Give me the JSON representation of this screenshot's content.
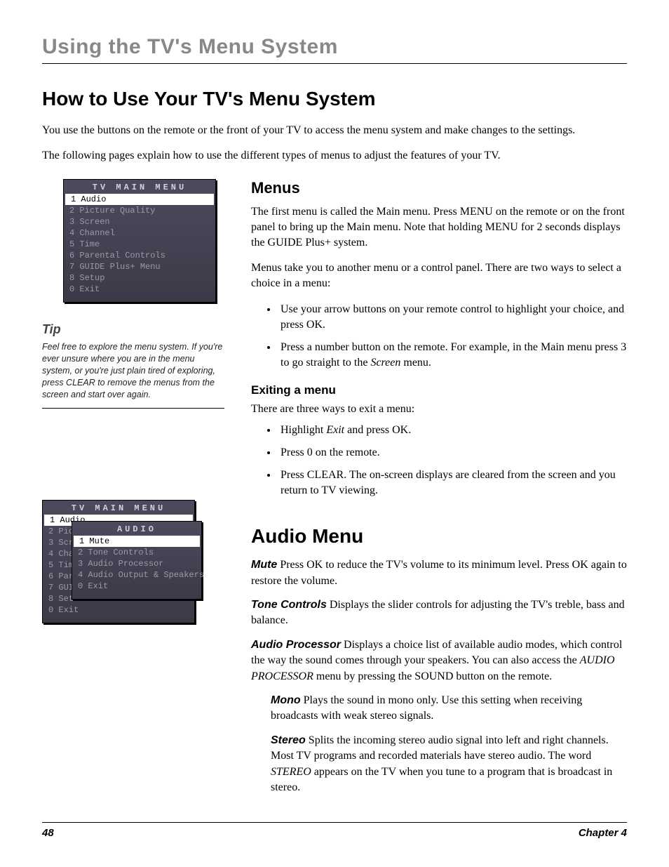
{
  "running_head": "Using the TV's Menu System",
  "h1": "How to Use Your TV's Menu System",
  "intro1": "You use the buttons on the remote or the front of your TV to access the menu system and make changes to the settings.",
  "intro2": "The following pages explain how to use the different types of menus to adjust the features of your TV.",
  "osd1": {
    "title": "TV MAIN MENU",
    "items": [
      {
        "n": "1",
        "label": "Audio",
        "selected": true
      },
      {
        "n": "2",
        "label": "Picture Quality"
      },
      {
        "n": "3",
        "label": "Screen"
      },
      {
        "n": "4",
        "label": "Channel"
      },
      {
        "n": "5",
        "label": "Time"
      },
      {
        "n": "6",
        "label": "Parental Controls"
      },
      {
        "n": "7",
        "label": "GUIDE Plus+ Menu"
      },
      {
        "n": "8",
        "label": "Setup"
      },
      {
        "n": "0",
        "label": "Exit"
      }
    ]
  },
  "tip": {
    "title": "Tip",
    "body": "Feel free to explore the menu system. If you're ever unsure where you are in the menu system, or you're just plain tired of exploring, press CLEAR to remove the menus from the screen and start over again."
  },
  "menus": {
    "heading": "Menus",
    "p1": "The first menu is called the Main menu. Press MENU on the remote or on the front panel to bring up the Main menu. Note that holding MENU for 2 seconds displays the GUIDE Plus+ system.",
    "p2": "Menus take you to another menu or a control panel. There are two ways to select a choice in a menu:",
    "bullets": [
      "Use your arrow buttons on your remote control to highlight your choice, and press OK.",
      "Press a number button on the remote. For example, in the Main menu press 3 to go straight to the Screen menu."
    ],
    "exit_heading": "Exiting a menu",
    "exit_intro": "There are three ways to exit a menu:",
    "exit_bullets": [
      "Highlight Exit and press OK.",
      "Press 0 on the remote.",
      "Press CLEAR. The on-screen displays are cleared from the screen and you return to TV viewing."
    ]
  },
  "osd2": {
    "back_title": "TV MAIN MENU",
    "back_items": [
      {
        "n": "1",
        "label": "Audio",
        "selected": true
      },
      {
        "n": "2",
        "label": "Pict"
      },
      {
        "n": "3",
        "label": "Scre"
      },
      {
        "n": "4",
        "label": "Chan"
      },
      {
        "n": "5",
        "label": "Time"
      },
      {
        "n": "6",
        "label": "Pare"
      },
      {
        "n": "7",
        "label": "GUID"
      },
      {
        "n": "8",
        "label": "Setu"
      },
      {
        "n": "0",
        "label": "Exit"
      }
    ],
    "sub_title": "AUDIO",
    "sub_items": [
      {
        "n": "1",
        "label": "Mute",
        "selected": true
      },
      {
        "n": "2",
        "label": "Tone Controls"
      },
      {
        "n": "3",
        "label": "Audio Processor"
      },
      {
        "n": "4",
        "label": "Audio Output & Speakers"
      },
      {
        "n": "0",
        "label": "Exit"
      }
    ]
  },
  "audio": {
    "heading": "Audio Menu",
    "mute_term": "Mute",
    "mute_text": "  Press OK to reduce the TV's volume to its minimum level. Press OK again to restore the volume.",
    "tone_term": "Tone Controls",
    "tone_text": "   Displays the slider controls for adjusting the TV's treble, bass and balance.",
    "proc_term": "Audio Processor",
    "proc_text": "   Displays a choice list of available audio modes, which control the way the sound comes through your speakers. You can also access the AUDIO PROCESSOR menu by pressing the SOUND button on the remote.",
    "mono_term": "Mono",
    "mono_text": "   Plays the sound in mono only. Use this setting when receiving broadcasts with weak stereo signals.",
    "stereo_term": "Stereo",
    "stereo_text": "    Splits the incoming stereo audio signal into left and right channels. Most TV programs and recorded materials have stereo audio. The word STEREO appears on the TV when you tune to a program that is broadcast in stereo."
  },
  "footer": {
    "page": "48",
    "chapter": "Chapter 4"
  }
}
